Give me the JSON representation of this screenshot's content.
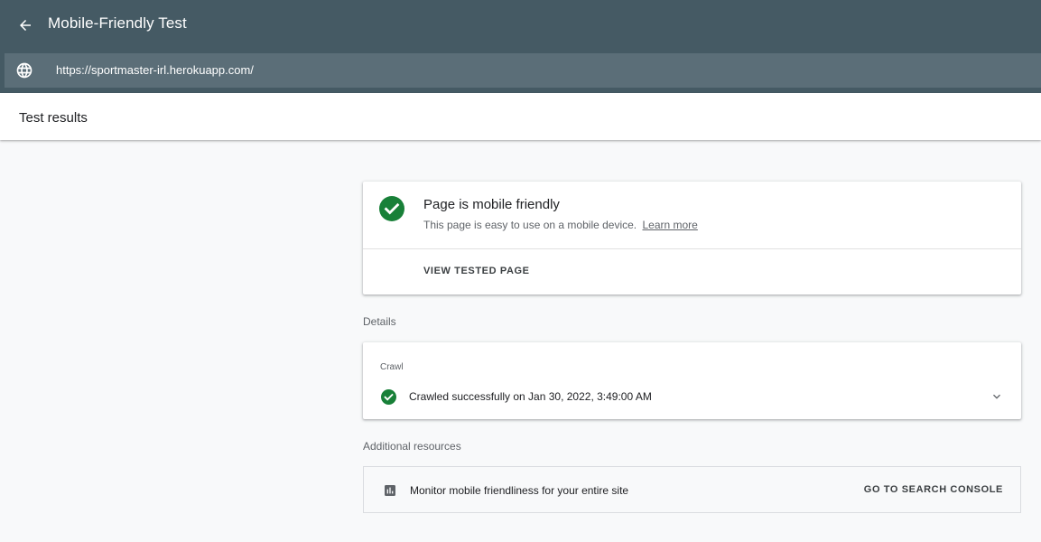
{
  "header": {
    "back_icon": "arrow-back-icon",
    "title": "Mobile-Friendly Test"
  },
  "url_bar": {
    "icon": "globe-icon",
    "value": "https://sportmaster-irl.herokuapp.com/"
  },
  "subheader": {
    "title": "Test results"
  },
  "result": {
    "status_icon": "check-circle-icon",
    "status_color": "#188038",
    "title": "Page is mobile friendly",
    "description": "This page is easy to use on a mobile device.",
    "learn_more": "Learn more",
    "view_button": "VIEW TESTED PAGE"
  },
  "details": {
    "label": "Details",
    "crawl": {
      "label": "Crawl",
      "status_icon": "check-circle-icon",
      "text": "Crawled successfully on Jan 30, 2022, 3:49:00 AM",
      "expand_icon": "chevron-down-icon"
    }
  },
  "resources": {
    "label": "Additional resources",
    "item": {
      "icon": "bar-chart-icon",
      "text": "Monitor mobile friendliness for your entire site",
      "button": "GO TO SEARCH CONSOLE"
    }
  },
  "colors": {
    "header_bg": "#455a64",
    "url_bar_bg": "#5b6e78",
    "success": "#188038"
  }
}
